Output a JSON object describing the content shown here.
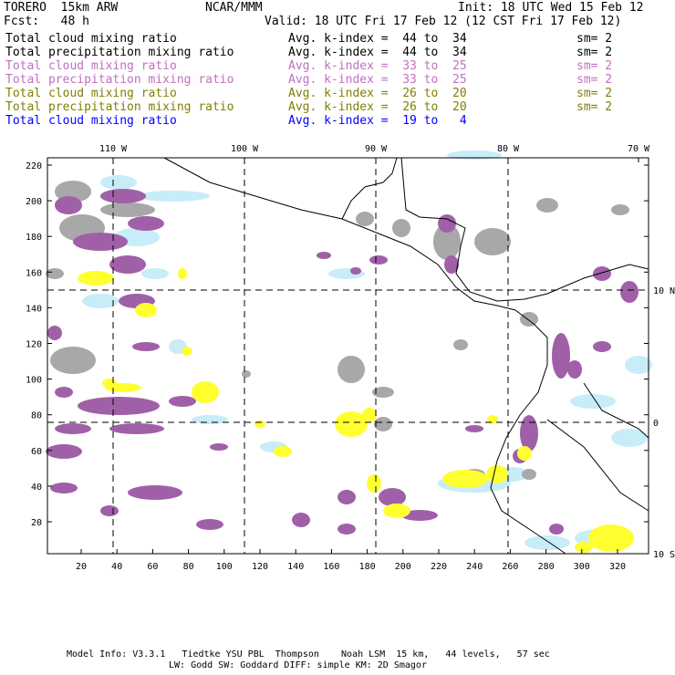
{
  "header": {
    "model": "TORERO  15km ARW",
    "org": "NCAR/MMM",
    "init": "Init: 18 UTC Wed 15 Feb 12",
    "fcst": "Fcst:   48 h",
    "valid": "Valid: 18 UTC Fri 17 Feb 12 (12 CST Fri 17 Feb 12)"
  },
  "legend": [
    {
      "field": "Total cloud mixing ratio",
      "range": "Avg. k-index =  44 to  34",
      "sm": "sm= 2",
      "color": "#000000"
    },
    {
      "field": "Total precipitation mixing ratio",
      "range": "Avg. k-index =  44 to  34",
      "sm": "sm= 2",
      "color": "#000000"
    },
    {
      "field": "Total cloud mixing ratio",
      "range": "Avg. k-index =  33 to  25",
      "sm": "sm= 2",
      "color": "#c070c0"
    },
    {
      "field": "Total precipitation mixing ratio",
      "range": "Avg. k-index =  33 to  25",
      "sm": "sm= 2",
      "color": "#c070c0"
    },
    {
      "field": "Total cloud mixing ratio",
      "range": "Avg. k-index =  26 to  20",
      "sm": "sm= 2",
      "color": "#808000"
    },
    {
      "field": "Total precipitation mixing ratio",
      "range": "Avg. k-index =  26 to  20",
      "sm": "sm= 2",
      "color": "#808000"
    },
    {
      "field": "Total cloud mixing ratio",
      "range": "Avg. k-index =  19 to   4",
      "sm": "",
      "color": "#0000ff"
    }
  ],
  "axes": {
    "top_lon": [
      "110 W",
      "100 W",
      "90 W",
      "80 W",
      "70 W"
    ],
    "right_lat": [
      "10 N",
      "0",
      "10 S"
    ],
    "left_y": [
      "220",
      "200",
      "180",
      "160",
      "140",
      "120",
      "100",
      "80",
      "60",
      "40",
      "20"
    ],
    "bottom_x": [
      "20",
      "40",
      "60",
      "80",
      "100",
      "120",
      "140",
      "160",
      "180",
      "200",
      "220",
      "240",
      "260",
      "280",
      "300",
      "320"
    ]
  },
  "footer": {
    "line1": "Model Info: V3.3.1   Tiedtke YSU PBL  Thompson    Noah LSM  15 km,   44 levels,   57 sec",
    "line2": "LW: Godd SW: Goddard DIFF: simple KM: 2D Smagor"
  },
  "colors": {
    "gray": "#a8a8a8",
    "purple": "#a060a8",
    "lightblue": "#c8ecf8",
    "yellow": "#ffff30"
  }
}
